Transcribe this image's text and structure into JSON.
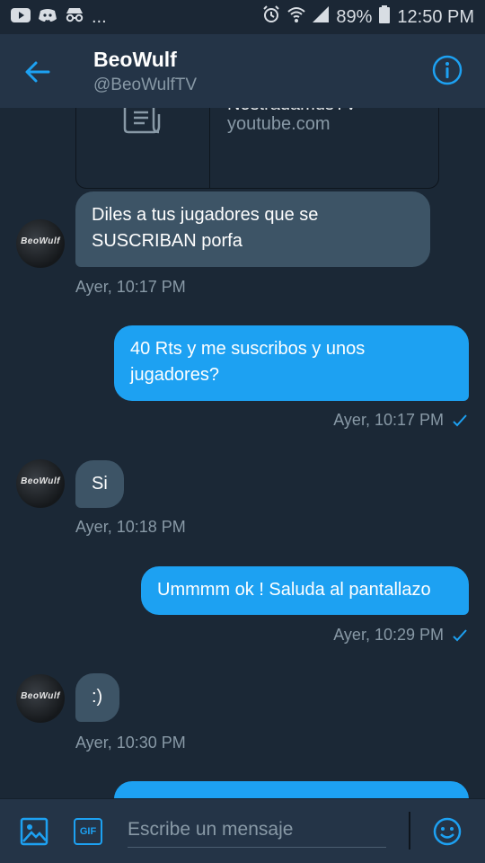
{
  "status_bar": {
    "left_ellipsis": "...",
    "battery": "89%",
    "time": "12:50 PM"
  },
  "header": {
    "name": "BeoWulf",
    "handle": "@BeoWulfTV"
  },
  "avatar_logo": "BeoWulf",
  "link_card": {
    "title": "NostradamusTV",
    "domain": "youtube.com"
  },
  "messages": [
    {
      "direction": "in",
      "text": "Diles a tus jugadores que se SUSCRIBAN porfa",
      "time": "Ayer, 10:17 PM"
    },
    {
      "direction": "out",
      "text": "40 Rts  y me suscribos y unos jugadores?",
      "time": "Ayer, 10:17 PM",
      "read": true
    },
    {
      "direction": "in",
      "text": "Si",
      "time": "Ayer, 10:18 PM"
    },
    {
      "direction": "out",
      "text": "Ummmm ok ! Saluda al pantallazo",
      "time": "Ayer, 10:29 PM",
      "read": true
    },
    {
      "direction": "in",
      "text": ":)",
      "time": "Ayer, 10:30 PM"
    }
  ],
  "compose": {
    "gif_label": "GIF",
    "placeholder": "Escribe un mensaje"
  },
  "colors": {
    "accent": "#1da1f2",
    "background": "#1b2836",
    "header": "#243447",
    "incoming_bubble": "#3d5466",
    "muted_text": "#8899a6"
  }
}
